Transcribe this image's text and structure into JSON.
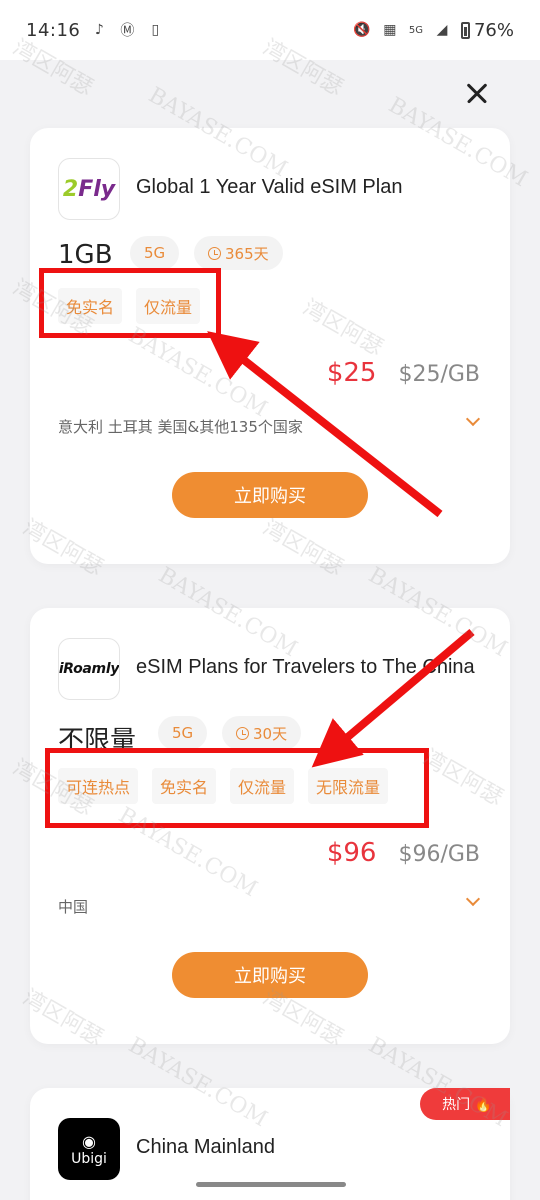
{
  "status_bar": {
    "time": "14:16",
    "network": "5G",
    "battery": "76%",
    "icons": [
      "tiktok-icon",
      "motorola-icon",
      "phone-sync-icon",
      "mute-icon",
      "sim-icon",
      "signal-icon",
      "battery-icon"
    ]
  },
  "close_label": "×",
  "watermark": [
    "湾区阿瑟",
    "BAYASE.COM"
  ],
  "plans": [
    {
      "logo": "2Fly",
      "title": "Global 1 Year Valid eSIM Plan",
      "data": "1GB",
      "network": "5G",
      "validity": "365天",
      "tags": [
        "免实名",
        "仅流量"
      ],
      "price": "$25",
      "price_per": "$25/GB",
      "countries": "意大利 土耳其 美国&其他135个国家",
      "buy_label": "立即购买"
    },
    {
      "logo": "iRoamly",
      "title": "eSIM Plans for Travelers to The China",
      "data": "不限量",
      "network": "5G",
      "validity": "30天",
      "tags": [
        "可连热点",
        "免实名",
        "仅流量",
        "无限流量"
      ],
      "price": "$96",
      "price_per": "$96/GB",
      "countries": "中国",
      "buy_label": "立即购买"
    },
    {
      "logo": "Ubigi",
      "title": "China Mainland",
      "badge": "热门 🔥"
    }
  ],
  "colors": {
    "accent_orange": "#ef8d32",
    "price_red": "#e8343d",
    "annotation_red": "#ee1111",
    "hot_badge": "#ef3b3b"
  }
}
